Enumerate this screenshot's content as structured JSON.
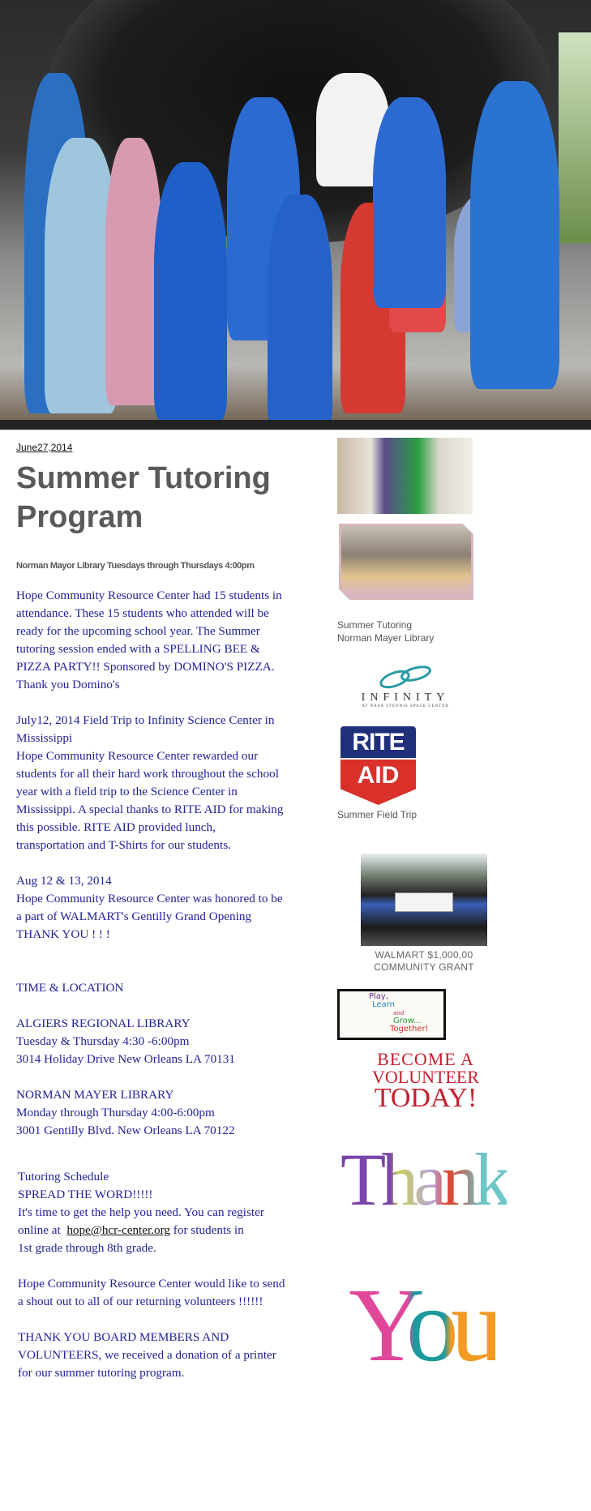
{
  "post": {
    "date": "June27,2014",
    "title": "Summer Tutoring Program",
    "subtitle": "Norman Mayor Library Tuesdays through Thursdays 4:00pm"
  },
  "paragraphs": {
    "p1": [
      "Hope Community Resource Center had 15 students in",
      "attendance. These 15 students who attended will be",
      "ready  for the upcoming school year.  The Summer",
      "tutoring session ended with a SPELLING BEE &",
      "PIZZA PARTY!!   Sponsored  by DOMINO'S PIZZA.",
      "Thank you  Domino's"
    ],
    "p2": [
      "July12, 2014 Field Trip to Infinity Science Center in",
      "Mississippi",
      "Hope Community Resource Center rewarded our",
      "students for all their hard work throughout the school",
      "year with a field trip to the  Science Center  in",
      "Mississippi. A special thanks to RITE AID for making",
      "this possible. RITE AID provided lunch,",
      "transportation and T-Shirts for our students."
    ],
    "p3": [
      "Aug 12 & 13, 2014",
      "Hope Community Resource Center was honored to be",
      "a part of WALMART's Gentilly Grand Opening",
      "THANK YOU ! ! !"
    ],
    "time_heading": "TIME & LOCATION",
    "p4": [
      "ALGIERS REGIONAL LIBRARY",
      "Tuesday & Thursday 4:30 -6:00pm",
      "3014 Holiday Drive New Orleans LA 70131"
    ],
    "p5": [
      "NORMAN MAYER LIBRARY",
      "Monday through Thursday 4:00-6:00pm",
      "3001 Gentilly Blvd. New Orleans LA 70122"
    ],
    "p6": [
      "Tutoring Schedule",
      "SPREAD THE WORD!!!!!",
      "It's time to get the help you need. You can register"
    ],
    "p6_online_prefix": "online at  ",
    "p6_email": "hope@hcr-center.org",
    "p6_online_suffix": " for students in",
    "p6_last": "1st grade through 8th grade.",
    "p7": [
      "Hope Community Resource Center would like to send",
      "a shout out to all of our returning volunteers !!!!!!"
    ],
    "p8": [
      "THANK YOU BOARD MEMBERS AND",
      "VOLUNTEERS, we received a donation of a printer",
      "for our summer tutoring program."
    ]
  },
  "sidebar": {
    "caption1": [
      "Summer Tutoring",
      "Norman Mayer Library"
    ],
    "infinity_logo": {
      "name": "INFINITY",
      "tag": "AT NASA STENNIS SPACE CENTER"
    },
    "riteaid_logo": [
      "RITE",
      "AID"
    ],
    "caption2": "Summer Field Trip",
    "walmart_caption": [
      "WALMART $1,000,00",
      "COMMUNITY GRANT"
    ],
    "play_logo": [
      "Play,",
      "Learn",
      "and",
      "Grow...",
      "Together!"
    ],
    "volunteer": [
      "BECOME A",
      "VOLUNTEER",
      "TODAY!"
    ],
    "thank_you": [
      "Thank",
      "You"
    ]
  },
  "colors": {
    "body_text": "#22229a",
    "title": "#5a5a5a",
    "rite_blue": "#1f2f7a",
    "rite_red": "#d9302a"
  }
}
